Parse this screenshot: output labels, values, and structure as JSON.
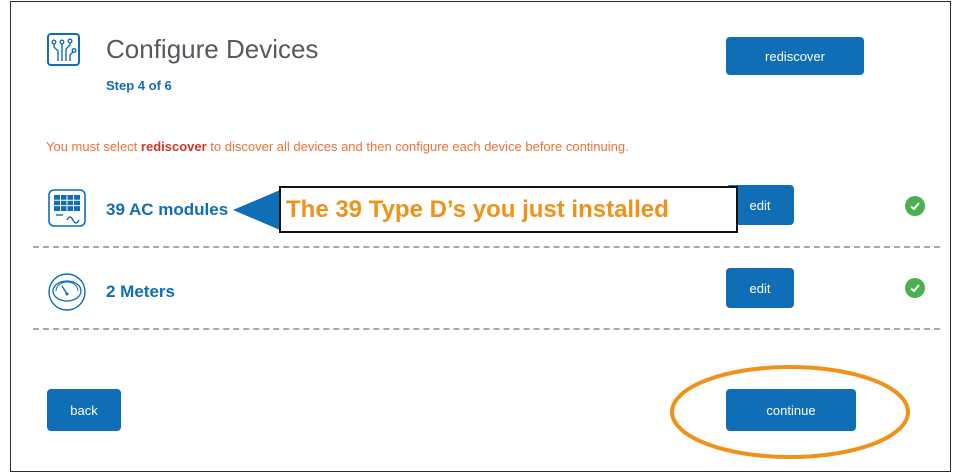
{
  "header": {
    "title": "Configure Devices",
    "step": "Step 4 of 6",
    "rediscover_label": "rediscover"
  },
  "notice": {
    "prefix": "You must select ",
    "emphasis": "rediscover",
    "suffix": " to discover all devices and then configure each device before continuing."
  },
  "devices": [
    {
      "label": "39 AC modules",
      "icon": "solar-panel-icon",
      "edit_label": "edit",
      "status": "complete"
    },
    {
      "label": "2 Meters",
      "icon": "meter-gauge-icon",
      "edit_label": "edit",
      "status": "complete"
    }
  ],
  "annotation": {
    "callout_text": "The 39 Type D’s you just installed"
  },
  "footer": {
    "back_label": "back",
    "continue_label": "continue"
  },
  "colors": {
    "primary": "#0f6eb5",
    "notice": "#f0703a",
    "notice_emphasis": "#d0362a",
    "success": "#4caf50",
    "callout_text": "#f0921a",
    "highlight_ring": "#f0921a"
  }
}
